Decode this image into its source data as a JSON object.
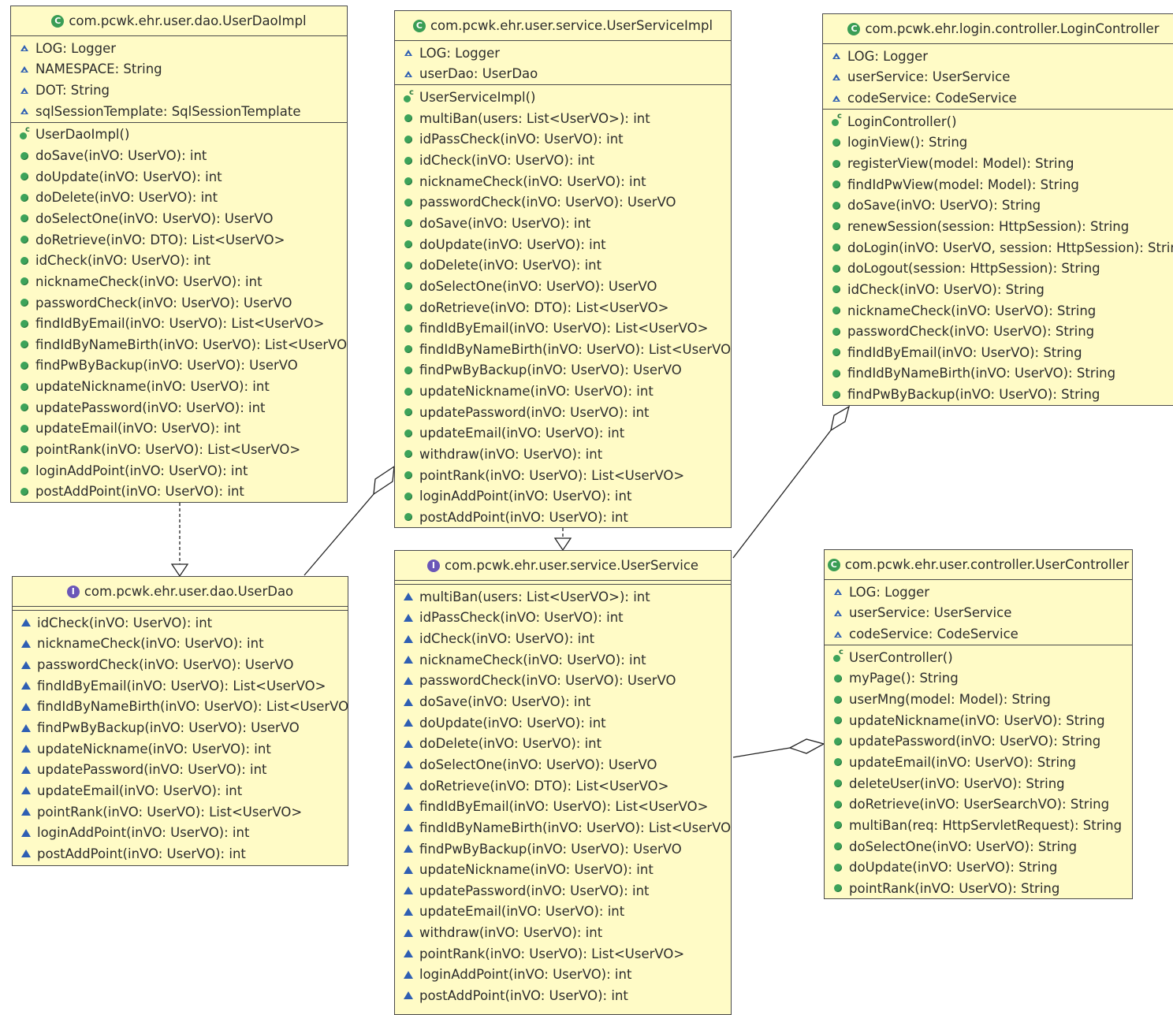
{
  "classes": {
    "userDaoImpl": {
      "name": "com.pcwk.ehr.user.dao.UserDaoImpl",
      "kind": "class",
      "attributes": [
        "LOG: Logger",
        "NAMESPACE: String",
        "DOT: String",
        "sqlSessionTemplate: SqlSessionTemplate"
      ],
      "operations": [
        "UserDaoImpl()",
        "doSave(inVO: UserVO): int",
        "doUpdate(inVO: UserVO): int",
        "doDelete(inVO: UserVO): int",
        "doSelectOne(inVO: UserVO): UserVO",
        "doRetrieve(inVO: DTO): List<UserVO>",
        "idCheck(inVO: UserVO): int",
        "nicknameCheck(inVO: UserVO): int",
        "passwordCheck(inVO: UserVO): UserVO",
        "findIdByEmail(inVO: UserVO): List<UserVO>",
        "findIdByNameBirth(inVO: UserVO): List<UserVO>",
        "findPwByBackup(inVO: UserVO): UserVO",
        "updateNickname(inVO: UserVO): int",
        "updatePassword(inVO: UserVO): int",
        "updateEmail(inVO: UserVO): int",
        "pointRank(inVO: UserVO): List<UserVO>",
        "loginAddPoint(inVO: UserVO): int",
        "postAddPoint(inVO: UserVO): int"
      ]
    },
    "userServiceImpl": {
      "name": "com.pcwk.ehr.user.service.UserServiceImpl",
      "kind": "class",
      "attributes": [
        "LOG: Logger",
        "userDao: UserDao"
      ],
      "operations": [
        "UserServiceImpl()",
        "multiBan(users: List<UserVO>): int",
        "idPassCheck(inVO: UserVO): int",
        "idCheck(inVO: UserVO): int",
        "nicknameCheck(inVO: UserVO): int",
        "passwordCheck(inVO: UserVO): UserVO",
        "doSave(inVO: UserVO): int",
        "doUpdate(inVO: UserVO): int",
        "doDelete(inVO: UserVO): int",
        "doSelectOne(inVO: UserVO): UserVO",
        "doRetrieve(inVO: DTO): List<UserVO>",
        "findIdByEmail(inVO: UserVO): List<UserVO>",
        "findIdByNameBirth(inVO: UserVO): List<UserVO>",
        "findPwByBackup(inVO: UserVO): UserVO",
        "updateNickname(inVO: UserVO): int",
        "updatePassword(inVO: UserVO): int",
        "updateEmail(inVO: UserVO): int",
        "withdraw(inVO: UserVO): int",
        "pointRank(inVO: UserVO): List<UserVO>",
        "loginAddPoint(inVO: UserVO): int",
        "postAddPoint(inVO: UserVO): int"
      ]
    },
    "loginController": {
      "name": "com.pcwk.ehr.login.controller.LoginController",
      "kind": "class",
      "attributes": [
        "LOG: Logger",
        "userService: UserService",
        "codeService: CodeService"
      ],
      "operations": [
        "LoginController()",
        "loginView(): String",
        "registerView(model: Model): String",
        "findIdPwView(model: Model): String",
        "doSave(inVO: UserVO): String",
        "renewSession(session: HttpSession): String",
        "doLogin(inVO: UserVO, session: HttpSession): String",
        "doLogout(session: HttpSession): String",
        "idCheck(inVO: UserVO): String",
        "nicknameCheck(inVO: UserVO): String",
        "passwordCheck(inVO: UserVO): String",
        "findIdByEmail(inVO: UserVO): String",
        "findIdByNameBirth(inVO: UserVO): String",
        "findPwByBackup(inVO: UserVO): String"
      ]
    },
    "userDao": {
      "name": "com.pcwk.ehr.user.dao.UserDao",
      "kind": "interface",
      "attributes": [],
      "operations": [
        "idCheck(inVO: UserVO): int",
        "nicknameCheck(inVO: UserVO): int",
        "passwordCheck(inVO: UserVO): UserVO",
        "findIdByEmail(inVO: UserVO): List<UserVO>",
        "findIdByNameBirth(inVO: UserVO): List<UserVO>",
        "findPwByBackup(inVO: UserVO): UserVO",
        "updateNickname(inVO: UserVO): int",
        "updatePassword(inVO: UserVO): int",
        "updateEmail(inVO: UserVO): int",
        "pointRank(inVO: UserVO): List<UserVO>",
        "loginAddPoint(inVO: UserVO): int",
        "postAddPoint(inVO: UserVO): int"
      ]
    },
    "userService": {
      "name": "com.pcwk.ehr.user.service.UserService",
      "kind": "interface",
      "attributes": [],
      "operations": [
        "multiBan(users: List<UserVO>): int",
        "idPassCheck(inVO: UserVO): int",
        "idCheck(inVO: UserVO): int",
        "nicknameCheck(inVO: UserVO): int",
        "passwordCheck(inVO: UserVO): UserVO",
        "doSave(inVO: UserVO): int",
        "doUpdate(inVO: UserVO): int",
        "doDelete(inVO: UserVO): int",
        "doSelectOne(inVO: UserVO): UserVO",
        "doRetrieve(inVO: DTO): List<UserVO>",
        "findIdByEmail(inVO: UserVO): List<UserVO>",
        "findIdByNameBirth(inVO: UserVO): List<UserVO>",
        "findPwByBackup(inVO: UserVO): UserVO",
        "updateNickname(inVO: UserVO): int",
        "updatePassword(inVO: UserVO): int",
        "updateEmail(inVO: UserVO): int",
        "withdraw(inVO: UserVO): int",
        "pointRank(inVO: UserVO): List<UserVO>",
        "loginAddPoint(inVO: UserVO): int",
        "postAddPoint(inVO: UserVO): int"
      ]
    },
    "userController": {
      "name": "com.pcwk.ehr.user.controller.UserController",
      "kind": "class",
      "attributes": [
        "LOG: Logger",
        "userService: UserService",
        "codeService: CodeService"
      ],
      "operations": [
        "UserController()",
        "myPage(): String",
        "userMng(model: Model): String",
        "updateNickname(inVO: UserVO): String",
        "updatePassword(inVO: UserVO): String",
        "updateEmail(inVO: UserVO): String",
        "deleteUser(inVO: UserVO): String",
        "doRetrieve(inVO: UserSearchVO): String",
        "multiBan(req: HttpServletRequest): String",
        "doSelectOne(inVO: UserVO): String",
        "doUpdate(inVO: UserVO): String",
        "pointRank(inVO: UserVO): String"
      ]
    }
  },
  "relations": [
    {
      "type": "realization",
      "from": "userDaoImpl",
      "to": "userDao"
    },
    {
      "type": "realization",
      "from": "userServiceImpl",
      "to": "userService"
    },
    {
      "type": "aggregation",
      "whole": "userServiceImpl",
      "part": "userDao"
    },
    {
      "type": "aggregation",
      "whole": "loginController",
      "part": "userService"
    },
    {
      "type": "aggregation",
      "whole": "userController",
      "part": "userService"
    }
  ]
}
